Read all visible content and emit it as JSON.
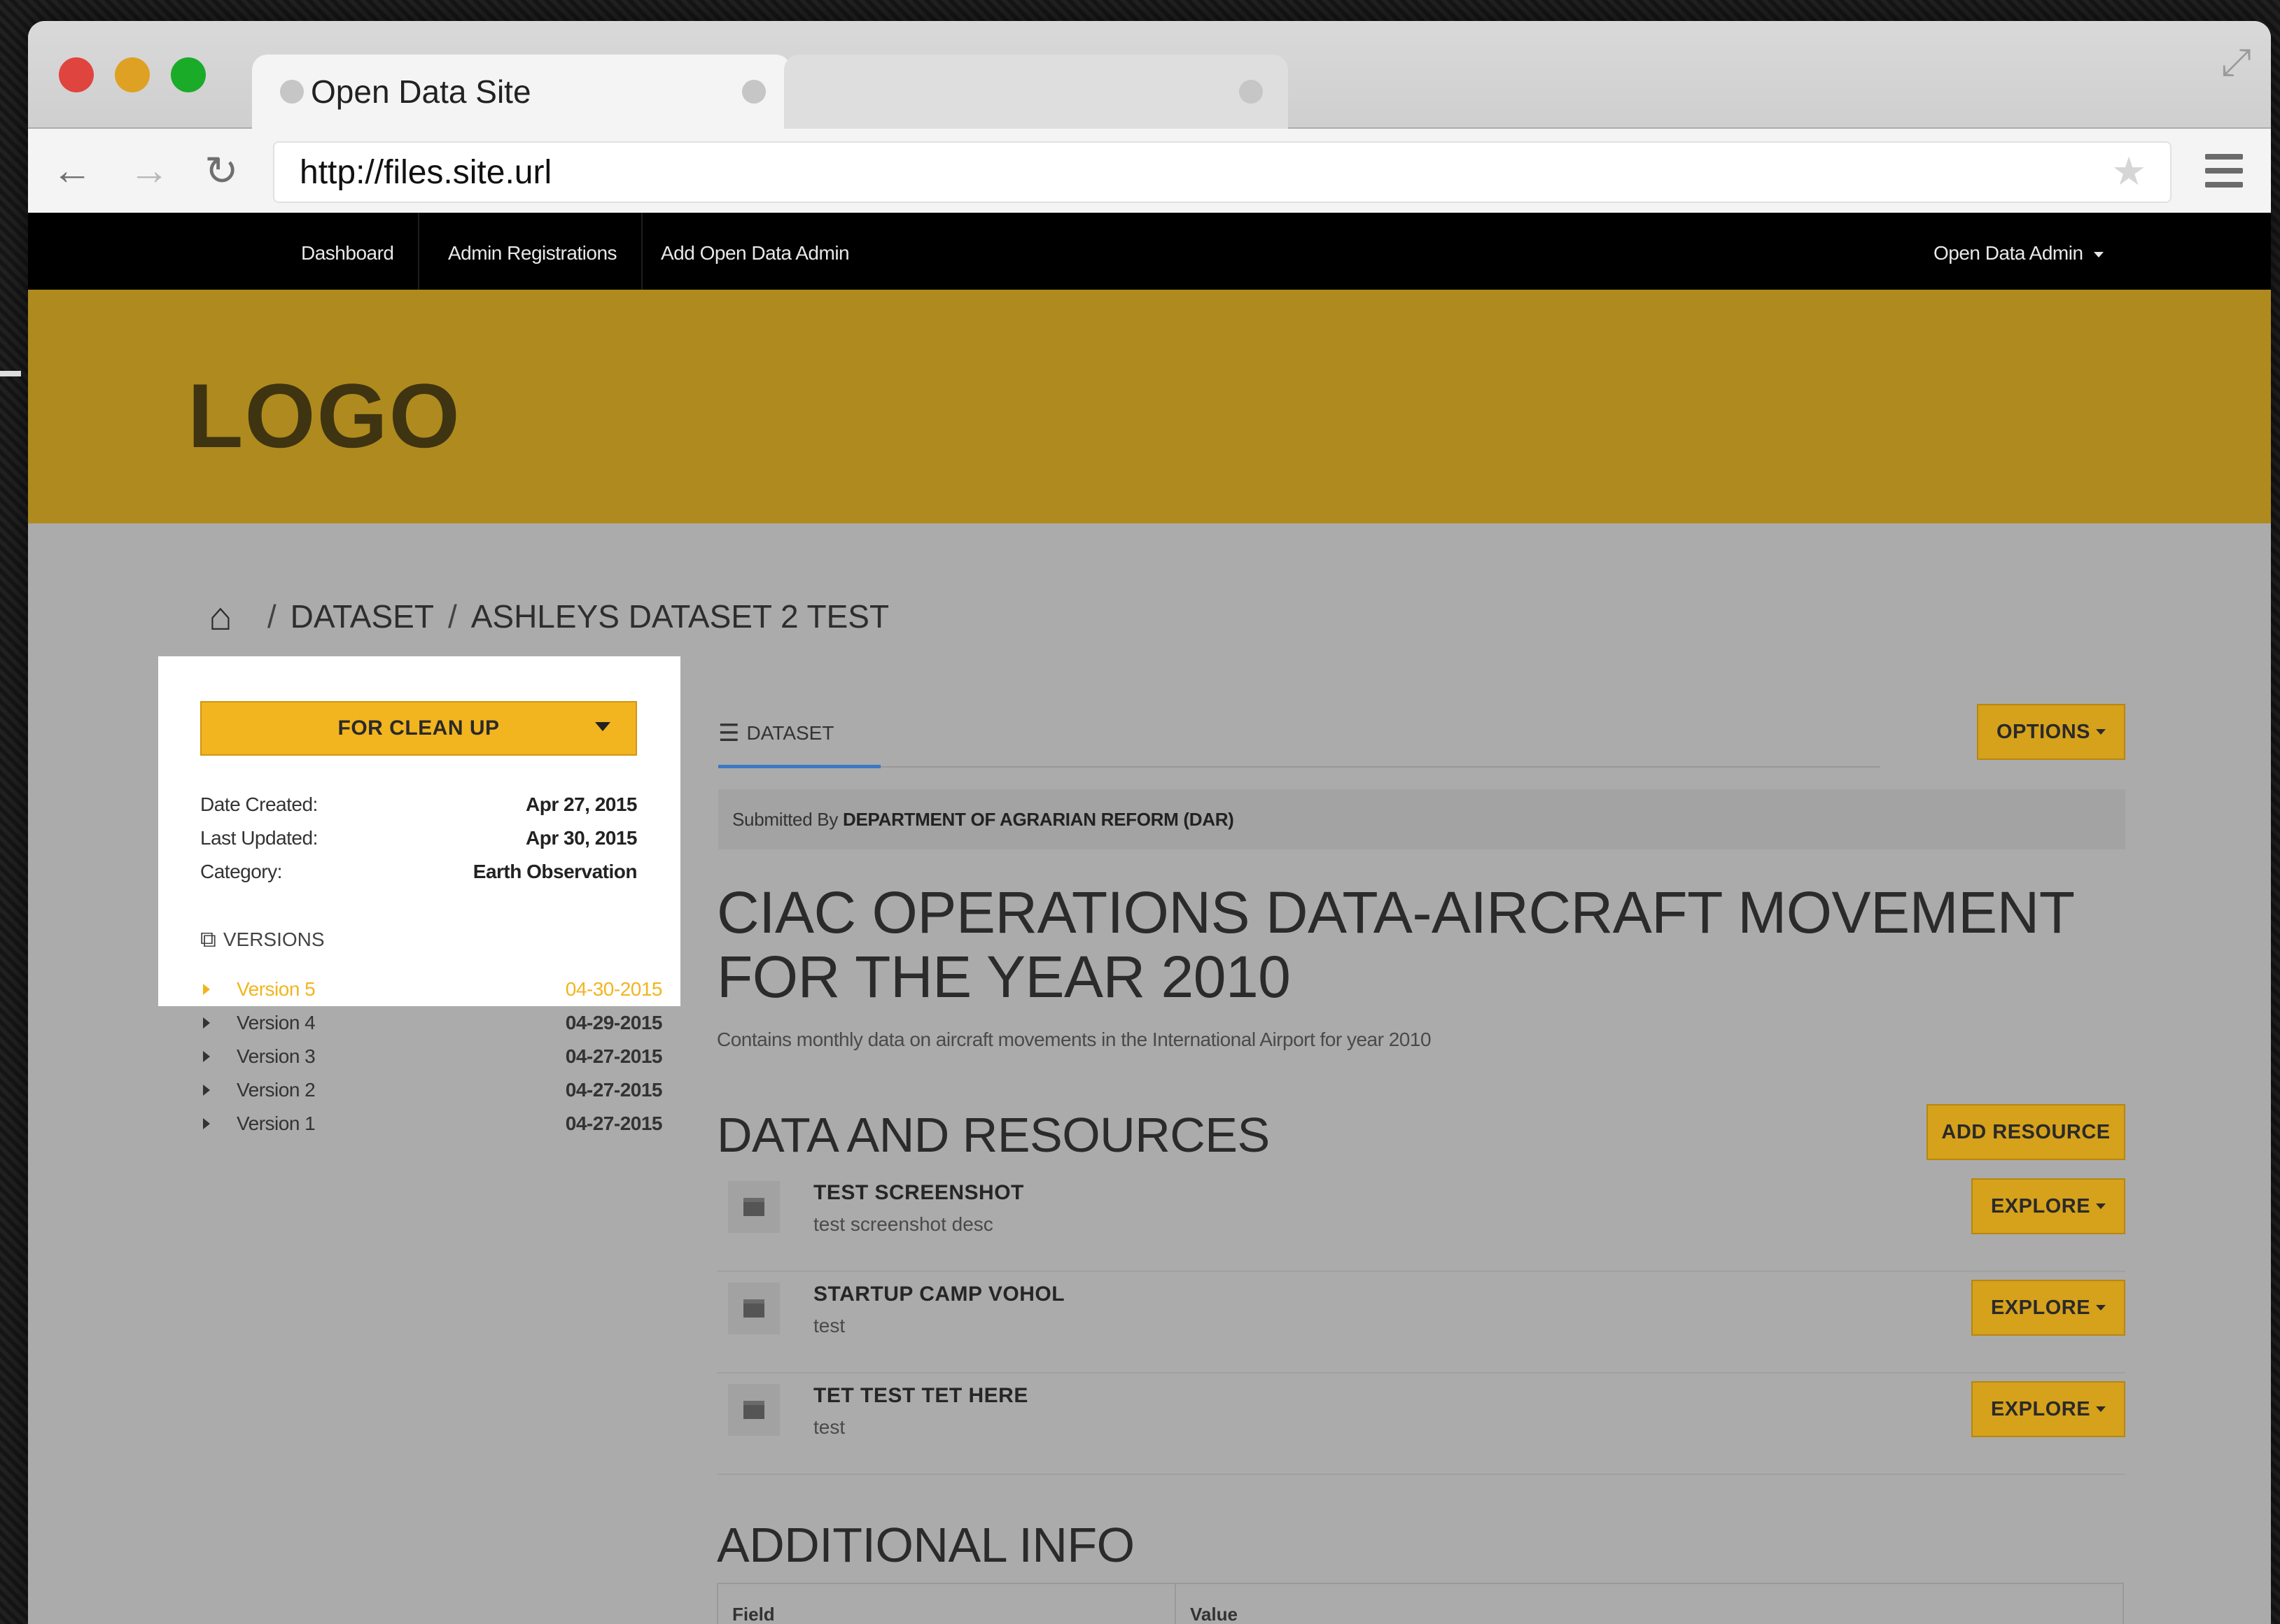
{
  "browser": {
    "tab_title": "Open Data Site",
    "url": "http://files.site.url"
  },
  "appnav": {
    "items": [
      "Dashboard",
      "Admin Registrations",
      "Add Open Data Admin"
    ],
    "user_menu": "Open Data Admin"
  },
  "header": {
    "logo": "LOGO",
    "color": "#af8a1e"
  },
  "breadcrumb": {
    "sep": "/",
    "items": [
      "DATASET",
      "ASHLEYS DATASET 2 TEST"
    ]
  },
  "sidebar": {
    "status_button": "FOR CLEAN UP",
    "meta": [
      {
        "label": "Date Created:",
        "value": "Apr 27, 2015"
      },
      {
        "label": "Last Updated:",
        "value": "Apr 30, 2015"
      },
      {
        "label": "Category:",
        "value": "Earth Observation"
      }
    ],
    "versions_heading": "VERSIONS",
    "versions": [
      {
        "label": "Version 5",
        "date": "04-30-2015"
      },
      {
        "label": "Version 4",
        "date": "04-29-2015"
      },
      {
        "label": "Version 3",
        "date": "04-27-2015"
      },
      {
        "label": "Version 2",
        "date": "04-27-2015"
      },
      {
        "label": "Version 1",
        "date": "04-27-2015"
      }
    ]
  },
  "main": {
    "tab_label": "DATASET",
    "options_button": "OPTIONS",
    "submitted_prefix": "Submitted By",
    "submitted_by": "DEPARTMENT OF AGRARIAN REFORM (DAR)",
    "title": "CIAC OPERATIONS DATA-AIRCRAFT MOVEMENT FOR THE YEAR 2010",
    "description": "Contains monthly data on aircraft movements in the International Airport for year 2010",
    "resources_heading": "DATA AND RESOURCES",
    "add_resource_button": "ADD RESOURCE",
    "resources": [
      {
        "name": "TEST SCREENSHOT",
        "desc": "test screenshot desc",
        "button": "EXPLORE"
      },
      {
        "name": "STARTUP CAMP VOHOL",
        "desc": "test",
        "button": "EXPLORE"
      },
      {
        "name": "TET TEST TET HERE",
        "desc": "test",
        "button": "EXPLORE"
      }
    ],
    "additional_heading": "ADDITIONAL INFO",
    "table_headers": [
      "Field",
      "Value"
    ]
  },
  "colors": {
    "accent": "#f2b51f",
    "button": "#d6a11b",
    "nav": "#000000"
  }
}
